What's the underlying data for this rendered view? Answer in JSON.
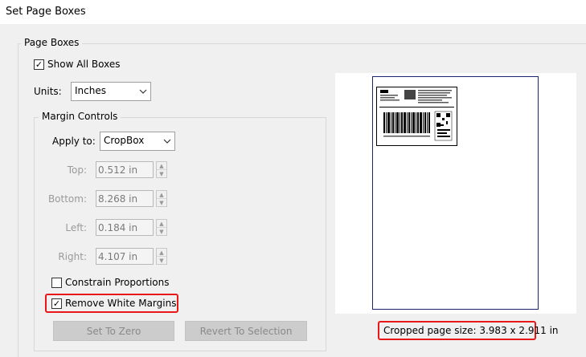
{
  "window": {
    "title": "Set Page Boxes"
  },
  "page_boxes": {
    "group_label": "Page Boxes",
    "show_all_boxes": {
      "label": "Show All Boxes",
      "checked": true
    },
    "units": {
      "label": "Units:",
      "value": "Inches"
    }
  },
  "margin_controls": {
    "group_label": "Margin Controls",
    "apply_to": {
      "label": "Apply to:",
      "value": "CropBox"
    },
    "fields": [
      {
        "label": "Top:",
        "value": "0.512 in"
      },
      {
        "label": "Bottom:",
        "value": "8.268 in"
      },
      {
        "label": "Left:",
        "value": "0.184 in"
      },
      {
        "label": "Right:",
        "value": "4.107 in"
      }
    ],
    "constrain_proportions": {
      "label": "Constrain Proportions",
      "checked": false
    },
    "remove_white_margins": {
      "label": "Remove White Margins",
      "checked": true
    },
    "set_to_zero_label": "Set To Zero",
    "revert_to_selection_label": "Revert To Selection"
  },
  "preview": {
    "cropped_size_text": "Cropped page size: 3.983 x 2.911 in"
  },
  "colors": {
    "highlight": "#e81818",
    "page_outline": "#1a2470"
  }
}
